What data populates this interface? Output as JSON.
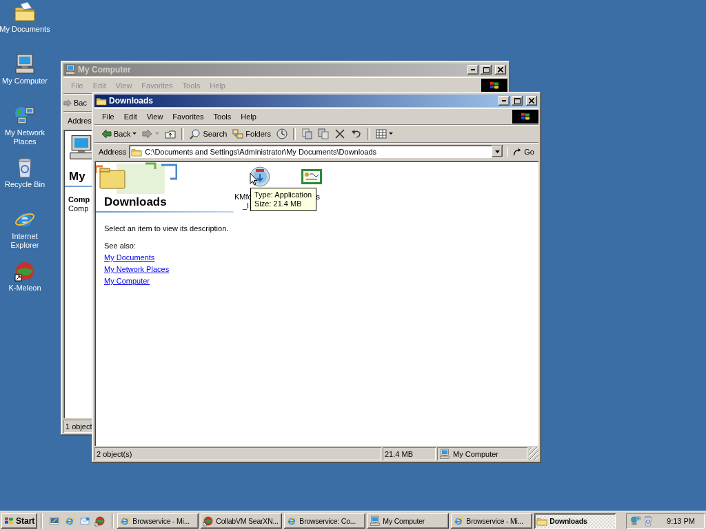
{
  "desktop_icons": [
    {
      "label": "My Documents",
      "kind": "documents"
    },
    {
      "label": "My Computer",
      "kind": "computer"
    },
    {
      "label": "My Network Places",
      "kind": "network"
    },
    {
      "label": "Recycle Bin",
      "kind": "recycle"
    },
    {
      "label": "Internet Explorer",
      "kind": "ie"
    },
    {
      "label": "K-Meleon",
      "kind": "kmeleon"
    }
  ],
  "back_window": {
    "title": "My Computer",
    "menu": [
      "File",
      "Edit",
      "View",
      "Favorites",
      "Tools",
      "Help"
    ],
    "back_label": "Bac",
    "address_label": "Addres",
    "pane_title": "My",
    "pane_heading": "Comp",
    "pane_text": "Comp",
    "status": "1 object"
  },
  "active_window": {
    "title": "Downloads",
    "menu": [
      "File",
      "Edit",
      "View",
      "Favorites",
      "Tools",
      "Help"
    ],
    "toolbar": [
      {
        "kind": "back",
        "label": "Back"
      },
      {
        "kind": "forward"
      },
      {
        "kind": "up"
      },
      {
        "kind": "separator"
      },
      {
        "kind": "search",
        "label": "Search"
      },
      {
        "kind": "folders",
        "label": "Folders"
      },
      {
        "kind": "history"
      },
      {
        "kind": "separator"
      },
      {
        "kind": "move"
      },
      {
        "kind": "copy"
      },
      {
        "kind": "delete"
      },
      {
        "kind": "undo"
      },
      {
        "kind": "separator"
      },
      {
        "kind": "views"
      }
    ],
    "address": {
      "label": "Address",
      "value": "C:\\Documents and Settings\\Administrator\\My Documents\\Downloads",
      "go": "Go"
    },
    "pane": {
      "title": "Downloads",
      "description": "Select an item to view its description.",
      "see_also": "See also:",
      "links": [
        "My Documents",
        "My Network Places",
        "My Computer"
      ]
    },
    "files": [
      {
        "kind": "installer",
        "label": [
          "KMfo",
          "_I"
        ]
      },
      {
        "kind": "certificate",
        "label": [
          "s"
        ]
      }
    ],
    "tooltip": [
      "Type: Application",
      "Size: 21.4 MB"
    ],
    "status_bar": {
      "objects": "2 object(s)",
      "size": "21.4 MB",
      "zone": "My Computer"
    }
  },
  "taskbar": {
    "start": "Start",
    "tasks": [
      {
        "label": "Browservice - Mi...",
        "kind": "ie",
        "selected": false
      },
      {
        "label": "CollabVM SearXN...",
        "kind": "kmeleon",
        "selected": false
      },
      {
        "label": "Browservice: Co...",
        "kind": "ie",
        "selected": false
      },
      {
        "label": "My Computer",
        "kind": "computer",
        "selected": false
      },
      {
        "label": "Browservice - Mi...",
        "kind": "ie",
        "selected": false
      },
      {
        "label": "Downloads",
        "kind": "folder",
        "selected": true
      }
    ],
    "clock": "9:13 PM"
  }
}
